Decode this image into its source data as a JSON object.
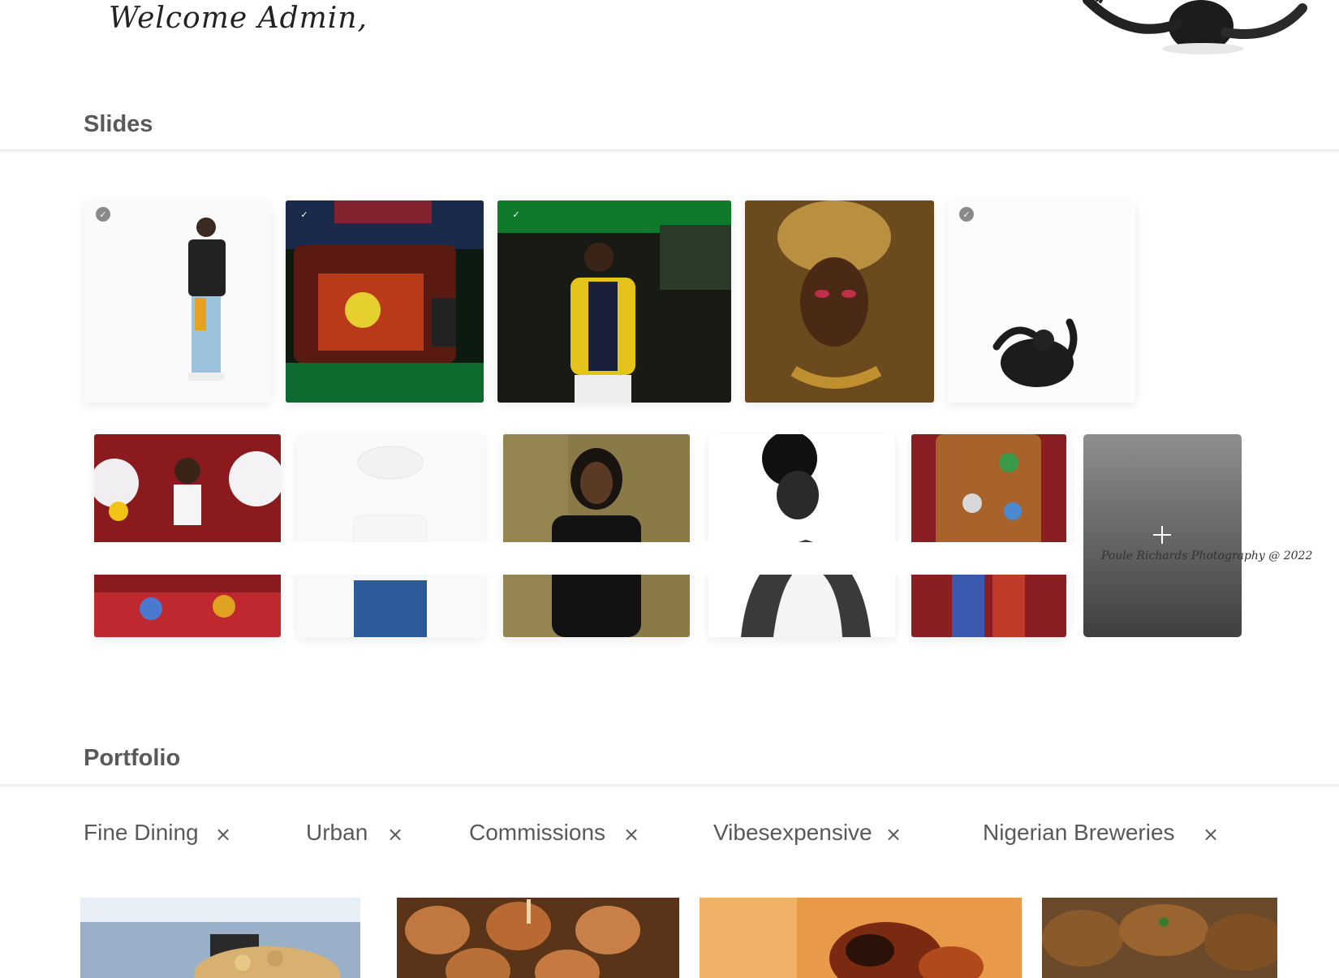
{
  "header": {
    "greeting": "Welcome Admin,"
  },
  "slides_section": {
    "title": "Slides",
    "add_icon": "plus-icon",
    "watermark": "Poule Richards Photography @ 2022",
    "row1": [
      {
        "name": "white-backdrop-streetwear",
        "selected": true,
        "check": "grey"
      },
      {
        "name": "camera-monitor-performance",
        "selected": true,
        "check": "clear"
      },
      {
        "name": "singer-green-studio",
        "selected": true,
        "check": "clear"
      },
      {
        "name": "gold-headwrap-portrait",
        "selected": false,
        "check": "none"
      },
      {
        "name": "silhouette-figure",
        "selected": true,
        "check": "grey"
      }
    ],
    "row2": [
      {
        "name": "floral-red-portrait"
      },
      {
        "name": "white-hat-back-view"
      },
      {
        "name": "black-blazer-portrait"
      },
      {
        "name": "bw-profile-portrait"
      },
      {
        "name": "patchwork-jacket"
      }
    ]
  },
  "portfolio_section": {
    "title": "Portfolio",
    "categories": [
      {
        "label": "Fine Dining",
        "close": "×"
      },
      {
        "label": "Urban",
        "close": "×"
      },
      {
        "label": "Commissions",
        "close": "×"
      },
      {
        "label": "Vibesexpensive",
        "close": "×"
      },
      {
        "label": "Nigerian Breweries",
        "close": "×"
      }
    ],
    "thumbnails": [
      "popcorn-dish",
      "stuffed-buns",
      "grilled-chicken",
      "fried-fritters"
    ]
  },
  "colors": {
    "title_text": "#595959",
    "add_tile_top": "#8e8e8e",
    "add_tile_bottom": "#3f3f3f"
  }
}
